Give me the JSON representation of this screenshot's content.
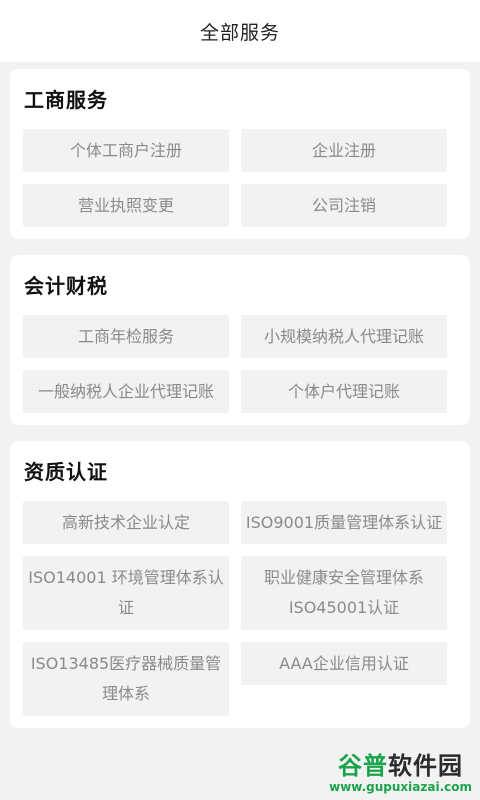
{
  "header": {
    "title": "全部服务"
  },
  "sections": [
    {
      "title": "工商服务",
      "items": [
        "个体工商户注册",
        "企业注册",
        "营业执照变更",
        "公司注销"
      ]
    },
    {
      "title": "会计财税",
      "items": [
        "工商年检服务",
        "小规模纳税人代理记账",
        "一般纳税人企业代理记账",
        "个体户代理记账"
      ]
    },
    {
      "title": "资质认证",
      "items": [
        "高新技术企业认定",
        "ISO9001质量管理体系认证",
        "ISO14001 环境管理体系认证",
        "职业健康安全管理体系ISO45001认证",
        "ISO13485医疗器械质量管理体系",
        "AAA企业信用认证"
      ]
    }
  ],
  "watermark": {
    "logo_a": "谷普",
    "logo_b": "软件园",
    "url": "www.gupuxiazai.com"
  },
  "colors": {
    "background": "#f2f2f2",
    "card": "#ffffff",
    "item_bg": "#f2f2f2",
    "item_text": "#8a8a8a",
    "watermark": "#1aa34a"
  }
}
